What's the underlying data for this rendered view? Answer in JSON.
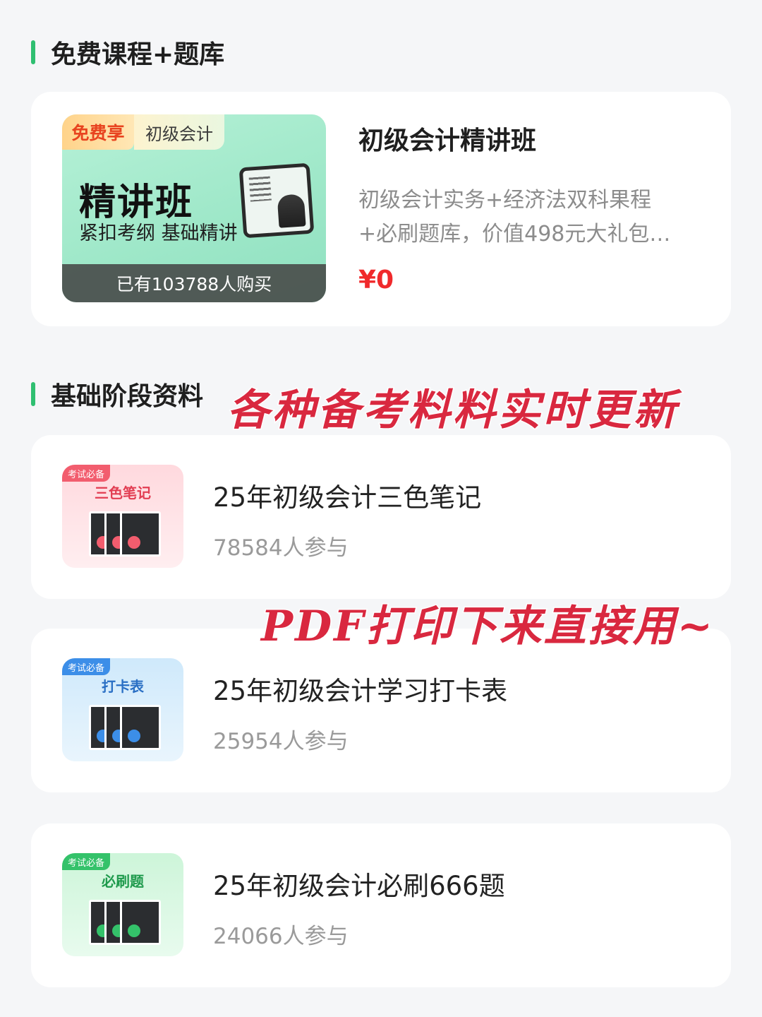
{
  "section_free": {
    "title": "免费课程+题库"
  },
  "course": {
    "tag_free": "免费享",
    "tag_subject": "初级会计",
    "thumb_title": "精讲班",
    "thumb_subtitle": "紧扣考纲 基础精讲",
    "purchased": "已有103788人购买",
    "title": "初级会计精讲班",
    "description": "初级会计实务+经济法双科果程+必刷题库，价值498元大礼包…",
    "price": "¥0"
  },
  "section_basic": {
    "title": "基础阶段资料"
  },
  "annotations": {
    "updates": "各种备考料料实时更新",
    "print": "PDF打印下来直接用~"
  },
  "materials": [
    {
      "tag": "考试必备",
      "cover_label": "三色笔记",
      "title": "25年初级会计三色笔记",
      "count": "78584人参与",
      "accent": "#f25d6e"
    },
    {
      "tag": "考试必备",
      "cover_label": "打卡表",
      "title": "25年初级会计学习打卡表",
      "count": "25954人参与",
      "accent": "#3c8ee8"
    },
    {
      "tag": "考试必备",
      "cover_label": "必刷题",
      "title": "25年初级会计必刷666题",
      "count": "24066人参与",
      "accent": "#34c26a"
    }
  ],
  "colors": {
    "brand_green": "#2fbf71",
    "price_red": "#f0292b",
    "handwriting_red": "#d9283f"
  }
}
